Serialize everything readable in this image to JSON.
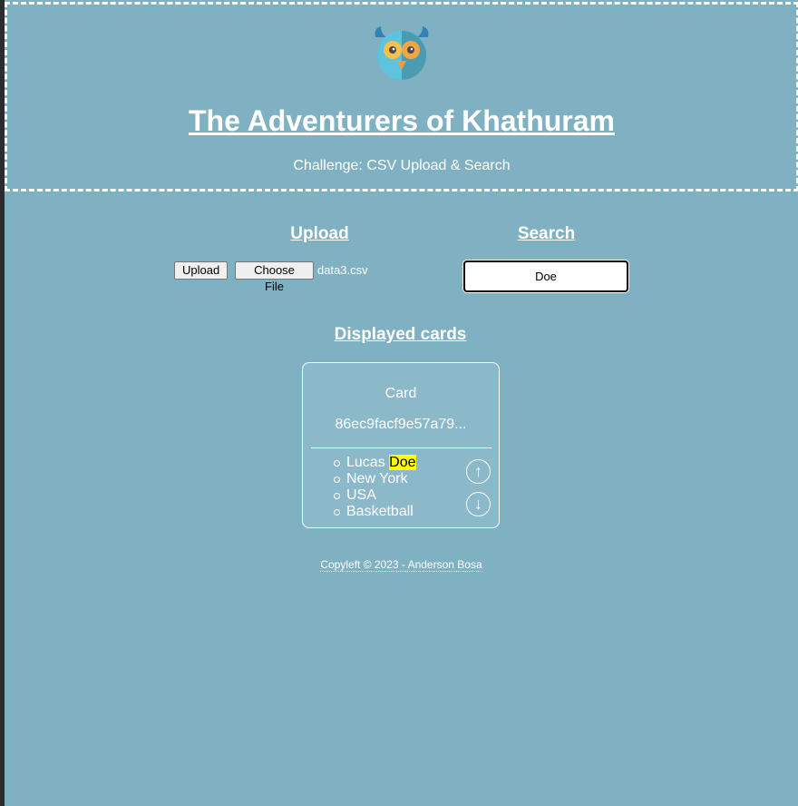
{
  "header": {
    "title": "The Adventurers of Khathuram",
    "subtitle": "Challenge: CSV Upload & Search",
    "logo_icon": "owl-icon"
  },
  "upload": {
    "heading": "Upload",
    "upload_button": "Upload",
    "choose_file_button": "Choose File",
    "file_name": "data3.csv"
  },
  "search": {
    "heading": "Search",
    "value": "Doe"
  },
  "cards_section": {
    "heading": "Displayed cards",
    "cards": [
      {
        "title": "Card",
        "id": "86ec9facf9e57a79...",
        "fields": {
          "first_name": "Lucas ",
          "match": "Doe",
          "city": "New York",
          "country": "USA",
          "sport": "Basketball"
        },
        "up_icon": "↑",
        "down_icon": "↓"
      }
    ]
  },
  "footer": {
    "text": "Copyleft © 2023 - Anderson Bosa"
  },
  "colors": {
    "background": "#7fb1c3",
    "highlight": "#ffff00"
  }
}
